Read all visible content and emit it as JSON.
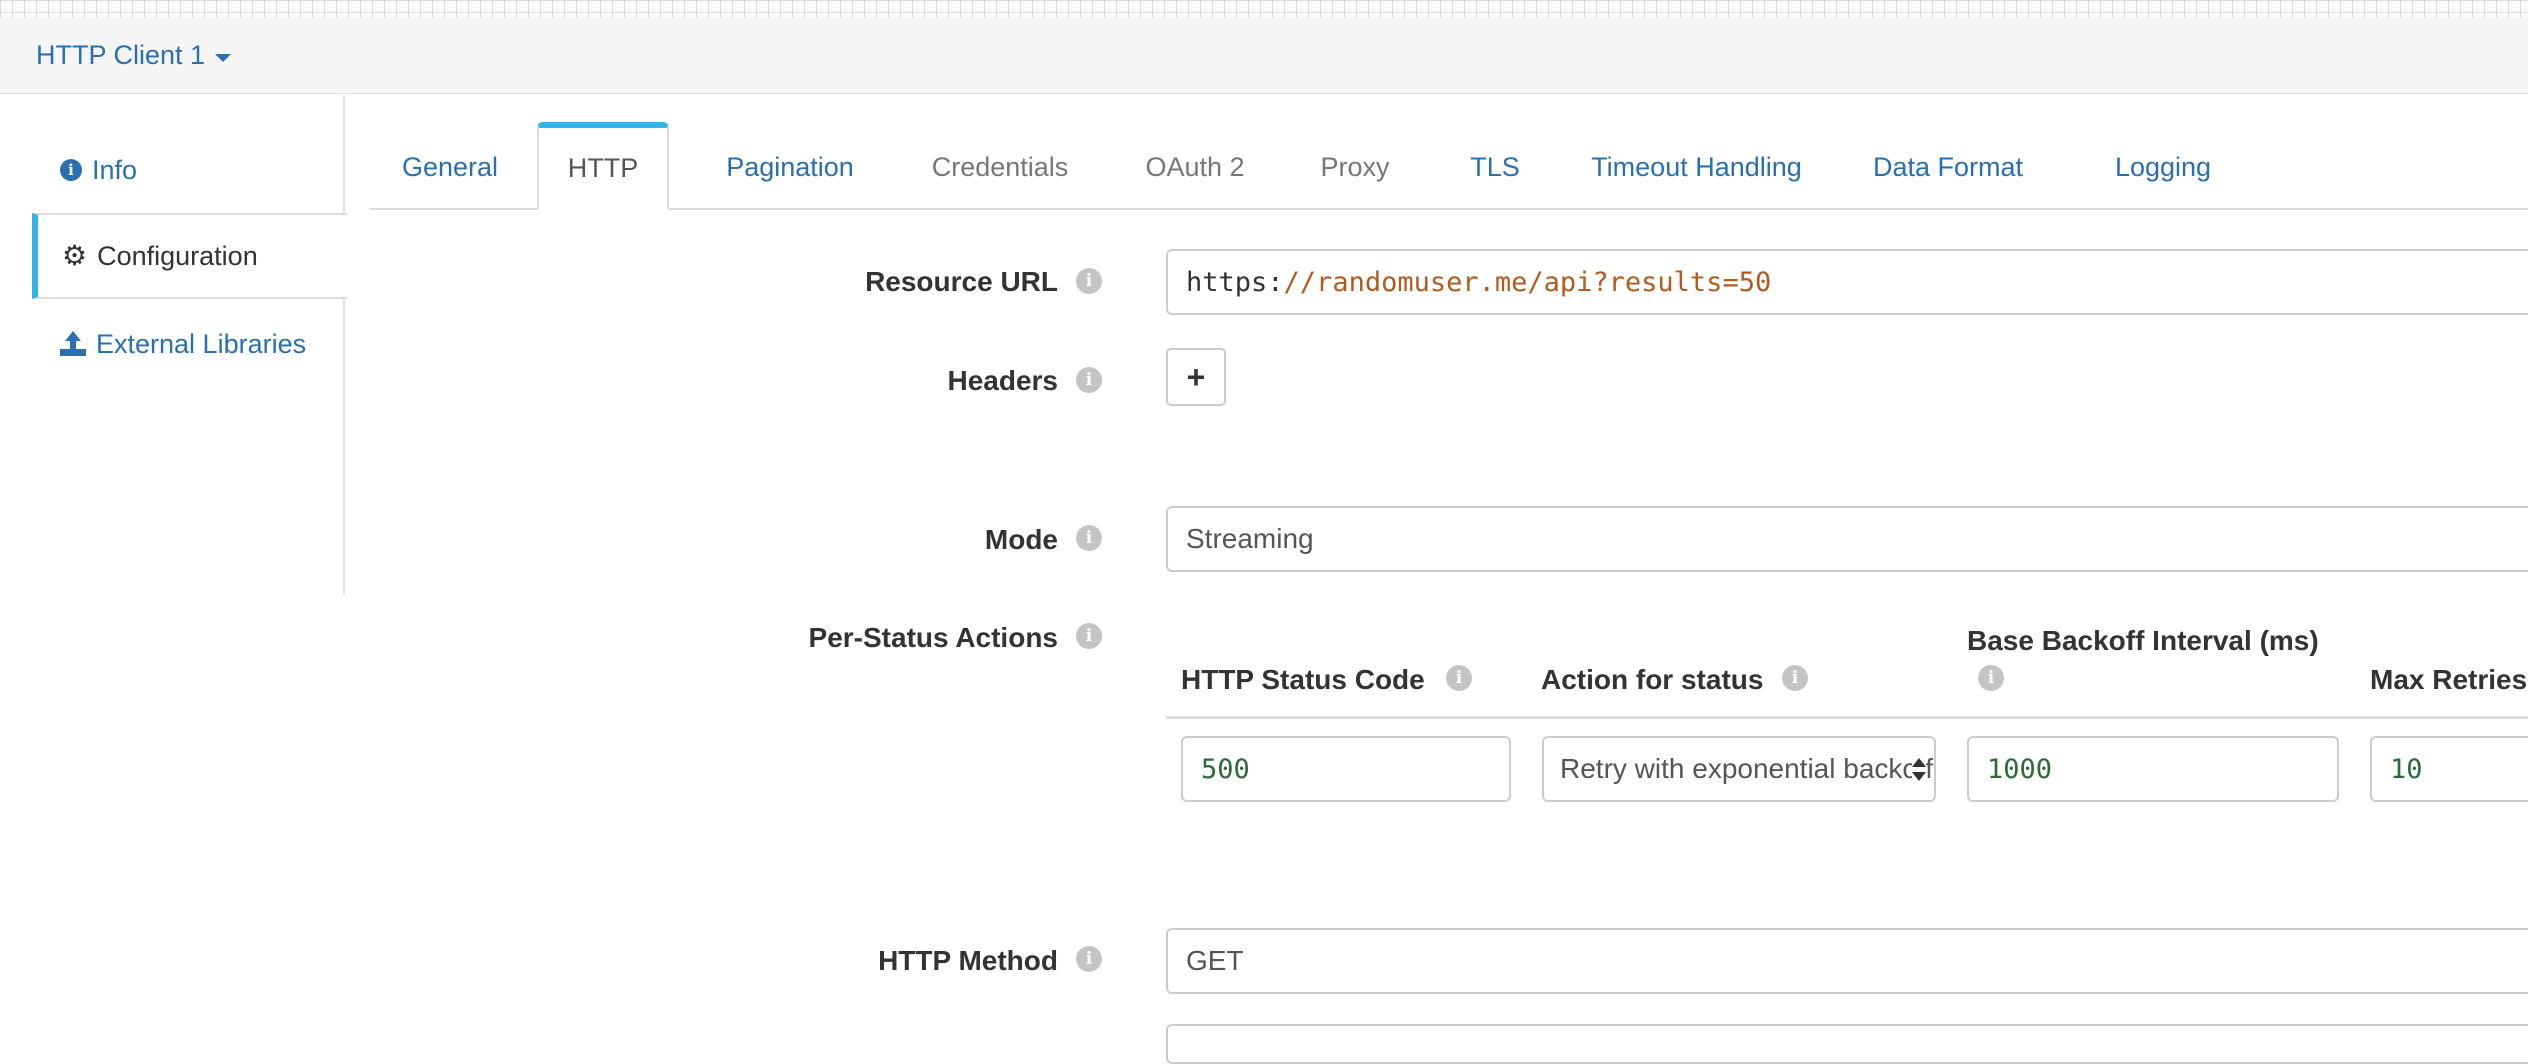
{
  "header": {
    "title": "HTTP Client 1"
  },
  "sidebar": {
    "items": [
      {
        "label": "Info",
        "icon": "info-circle-icon"
      },
      {
        "label": "Configuration",
        "icon": "gear-icon",
        "active": true
      },
      {
        "label": "External Libraries",
        "icon": "upload-icon"
      }
    ]
  },
  "tabs": [
    {
      "label": "General"
    },
    {
      "label": "HTTP",
      "active": true
    },
    {
      "label": "Pagination"
    },
    {
      "label": "Credentials"
    },
    {
      "label": "OAuth 2"
    },
    {
      "label": "Proxy"
    },
    {
      "label": "TLS"
    },
    {
      "label": "Timeout Handling"
    },
    {
      "label": "Data Format"
    },
    {
      "label": "Logging"
    }
  ],
  "form": {
    "resource_url": {
      "label": "Resource URL",
      "scheme": "https:",
      "rest": "//randomuser.me/api?results=50"
    },
    "headers": {
      "label": "Headers",
      "add_symbol": "+"
    },
    "mode": {
      "label": "Mode",
      "value": "Streaming"
    },
    "per_status": {
      "label": "Per-Status Actions",
      "columns": [
        "HTTP Status Code",
        "Action for status",
        "Base Backoff Interval (ms)",
        "Max Retries"
      ],
      "row": {
        "status_code": "500",
        "action": "Retry with exponential backoff",
        "backoff": "1000",
        "max_retries": "10"
      }
    },
    "http_method": {
      "label": "HTTP Method",
      "value": "GET"
    }
  },
  "colors": {
    "link": "#2a6fb0",
    "accent": "#33b5e5",
    "url_text": "#b35a1f",
    "number_text": "#2c6a3a"
  }
}
